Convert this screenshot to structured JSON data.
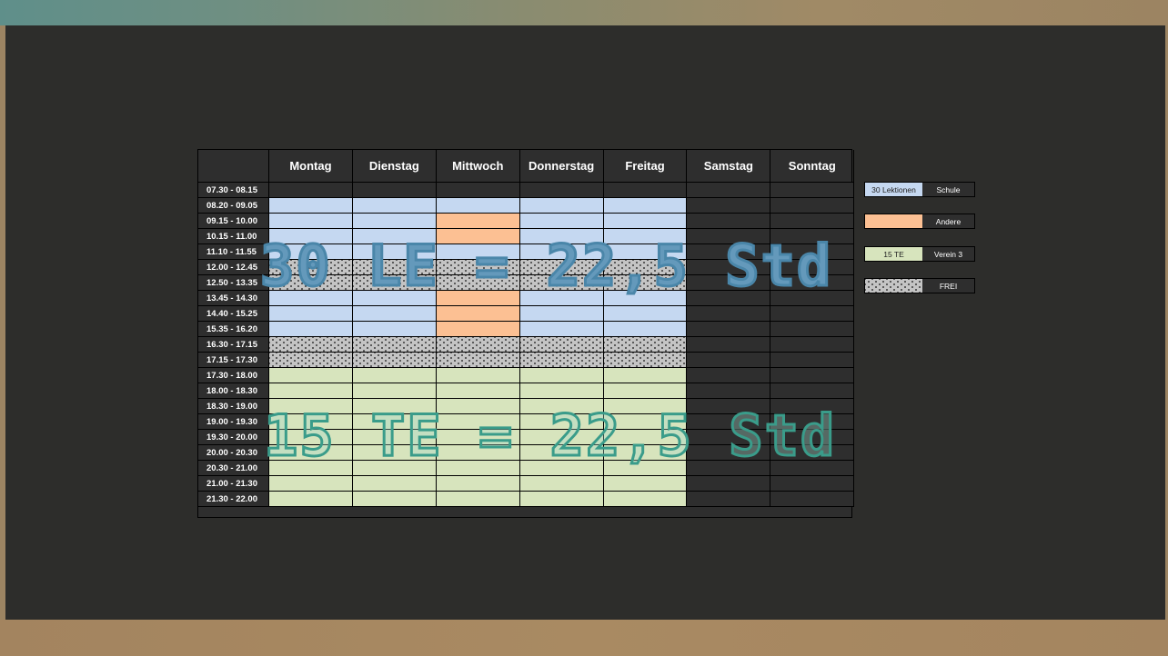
{
  "timetable": {
    "days": [
      "Montag",
      "Dienstag",
      "Mittwoch",
      "Donnerstag",
      "Freitag",
      "Samstag",
      "Sonntag"
    ],
    "times": [
      "07.30 - 08.15",
      "08.20 - 09.05",
      "09.15 - 10.00",
      "10.15 - 11.00",
      "11.10 - 11.55",
      "12.00 - 12.45",
      "12.50 - 13.35",
      "13.45 - 14.30",
      "14.40 - 15.25",
      "15.35 - 16.20",
      "16.30 - 17.15",
      "17.15 - 17.30",
      "17.30 - 18.00",
      "18.00 - 18.30",
      "18.30 - 19.00",
      "19.00 - 19.30",
      "19.30 - 20.00",
      "20.00 - 20.30",
      "20.30 - 21.00",
      "21.00 - 21.30",
      "21.30 - 22.00"
    ],
    "cells": [
      [
        "empty",
        "empty",
        "empty",
        "empty",
        "empty",
        "empty",
        "empty"
      ],
      [
        "schule",
        "schule",
        "schule",
        "schule",
        "schule",
        "empty",
        "empty"
      ],
      [
        "schule",
        "schule",
        "andere",
        "schule",
        "schule",
        "empty",
        "empty"
      ],
      [
        "schule",
        "schule",
        "andere",
        "schule",
        "schule",
        "empty",
        "empty"
      ],
      [
        "schule",
        "schule",
        "schule",
        "schule",
        "schule",
        "empty",
        "empty"
      ],
      [
        "frei",
        "frei",
        "frei",
        "frei",
        "frei",
        "empty",
        "empty"
      ],
      [
        "frei",
        "frei",
        "frei",
        "frei",
        "frei",
        "empty",
        "empty"
      ],
      [
        "schule",
        "schule",
        "andere",
        "schule",
        "schule",
        "empty",
        "empty"
      ],
      [
        "schule",
        "schule",
        "andere",
        "schule",
        "schule",
        "empty",
        "empty"
      ],
      [
        "schule",
        "schule",
        "andere",
        "schule",
        "schule",
        "empty",
        "empty"
      ],
      [
        "frei",
        "frei",
        "frei",
        "frei",
        "frei",
        "empty",
        "empty"
      ],
      [
        "frei",
        "frei",
        "frei",
        "frei",
        "frei",
        "empty",
        "empty"
      ],
      [
        "verein",
        "verein",
        "verein",
        "verein",
        "verein",
        "empty",
        "empty"
      ],
      [
        "verein",
        "verein",
        "verein",
        "verein",
        "verein",
        "empty",
        "empty"
      ],
      [
        "verein",
        "verein",
        "verein",
        "verein",
        "verein",
        "empty",
        "empty"
      ],
      [
        "verein",
        "verein",
        "verein",
        "verein",
        "verein",
        "empty",
        "empty"
      ],
      [
        "verein",
        "verein",
        "verein",
        "verein",
        "verein",
        "empty",
        "empty"
      ],
      [
        "verein",
        "verein",
        "verein",
        "verein",
        "verein",
        "empty",
        "empty"
      ],
      [
        "verein",
        "verein",
        "verein",
        "verein",
        "verein",
        "empty",
        "empty"
      ],
      [
        "verein",
        "verein",
        "verein",
        "verein",
        "verein",
        "empty",
        "empty"
      ],
      [
        "verein",
        "verein",
        "verein",
        "verein",
        "verein",
        "empty",
        "empty"
      ]
    ]
  },
  "legend": [
    {
      "swatch_text": "30 Lektionen",
      "label": "Schule",
      "type": "schule"
    },
    {
      "swatch_text": "",
      "label": "Andere",
      "type": "andere"
    },
    {
      "swatch_text": "15 TE",
      "label": "Verein 3",
      "type": "verein"
    },
    {
      "swatch_text": "",
      "label": "FREI",
      "type": "frei"
    }
  ],
  "overlays": {
    "school_total": "30 LE = 22,5 Std",
    "club_total": "15 TE = 22,5 Std"
  },
  "colors": {
    "background": "#2d2d2b",
    "schule": "#c5d8f1",
    "andere": "#fcc093",
    "verein": "#d7e4bd",
    "frei": "#c4c4c4",
    "overlay_school": "#4a86a9",
    "overlay_club": "#3a9c8a"
  }
}
